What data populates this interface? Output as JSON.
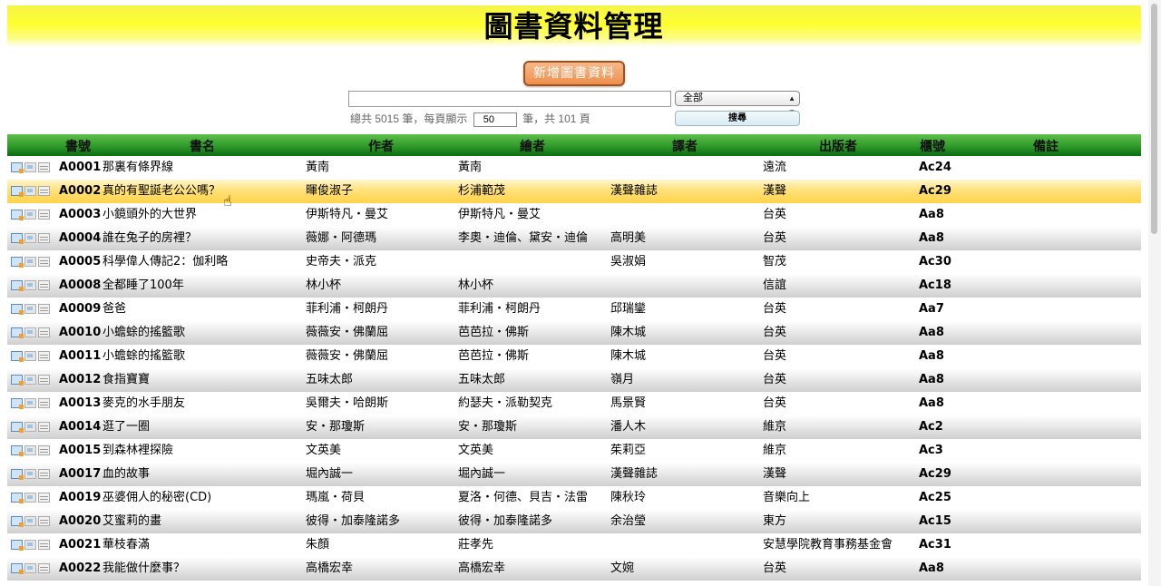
{
  "header": {
    "title": "圖書資料管理"
  },
  "actions": {
    "add_label": "新增圖書資料",
    "search_label": "搜尋"
  },
  "search": {
    "value": "",
    "category_selected": "全部"
  },
  "summary": {
    "prefix": "總共 5015 筆，每頁顯示",
    "per_page": "50",
    "suffix": "筆，共 101 頁"
  },
  "table": {
    "columns": [
      "書號",
      "書名",
      "作者",
      "繪者",
      "譯者",
      "出版者",
      "櫃號",
      "備註"
    ],
    "rows": [
      {
        "id": "A0001",
        "title": "那裏有條界線",
        "author": "黃南",
        "illustrator": "黃南",
        "translator": "",
        "publisher": "遠流",
        "shelf": "Ac24",
        "note": ""
      },
      {
        "id": "A0002",
        "title": "真的有聖誕老公公嗎？",
        "author": "暉俊淑子",
        "illustrator": "杉浦範茂",
        "translator": "漢聲雜誌",
        "publisher": "漢聲",
        "shelf": "Ac29",
        "note": ""
      },
      {
        "id": "A0003",
        "title": "小鏡頭外的大世界",
        "author": "伊斯特凡・曼艾",
        "illustrator": "伊斯特凡・曼艾",
        "translator": "",
        "publisher": "台英",
        "shelf": "Aa8",
        "note": ""
      },
      {
        "id": "A0004",
        "title": "誰在兔子的房裡？",
        "author": "薇娜・阿德瑪",
        "illustrator": "李奧・迪倫、黛安・迪倫",
        "translator": "高明美",
        "publisher": "台英",
        "shelf": "Aa8",
        "note": ""
      },
      {
        "id": "A0005",
        "title": "科學偉人傳記2：伽利略",
        "author": "史帝夫・派克",
        "illustrator": "",
        "translator": "吳淑娟",
        "publisher": "智茂",
        "shelf": "Ac30",
        "note": ""
      },
      {
        "id": "A0008",
        "title": "全都睡了100年",
        "author": "林小杯",
        "illustrator": "林小杯",
        "translator": "",
        "publisher": "信誼",
        "shelf": "Ac18",
        "note": ""
      },
      {
        "id": "A0009",
        "title": "爸爸",
        "author": "菲利浦・柯朗丹",
        "illustrator": "菲利浦・柯朗丹",
        "translator": "邱瑞鑾",
        "publisher": "台英",
        "shelf": "Aa7",
        "note": ""
      },
      {
        "id": "A0010",
        "title": "小蟾蜍的搖籃歌",
        "author": "薇薇安・佛蘭屈",
        "illustrator": "芭芭拉・佛斯",
        "translator": "陳木城",
        "publisher": "台英",
        "shelf": "Aa8",
        "note": ""
      },
      {
        "id": "A0011",
        "title": "小蟾蜍的搖籃歌",
        "author": "薇薇安・佛蘭屈",
        "illustrator": "芭芭拉・佛斯",
        "translator": "陳木城",
        "publisher": "台英",
        "shelf": "Aa8",
        "note": ""
      },
      {
        "id": "A0012",
        "title": "食指寶寶",
        "author": "五味太郎",
        "illustrator": "五味太郎",
        "translator": "嶺月",
        "publisher": "台英",
        "shelf": "Aa8",
        "note": ""
      },
      {
        "id": "A0013",
        "title": "麥克的水手朋友",
        "author": "吳爾夫・哈朗斯",
        "illustrator": "約瑟夫・派勒契克",
        "translator": "馬景賢",
        "publisher": "台英",
        "shelf": "Aa8",
        "note": ""
      },
      {
        "id": "A0014",
        "title": "逛了一圈",
        "author": "安・那瓊斯",
        "illustrator": "安・那瓊斯",
        "translator": "潘人木",
        "publisher": "維京",
        "shelf": "Ac2",
        "note": ""
      },
      {
        "id": "A0015",
        "title": "到森林裡探險",
        "author": "文英美",
        "illustrator": "文英美",
        "translator": "茱莉亞",
        "publisher": "維京",
        "shelf": "Ac3",
        "note": ""
      },
      {
        "id": "A0017",
        "title": "血的故事",
        "author": "堀內誠一",
        "illustrator": "堀內誠一",
        "translator": "漢聲雜誌",
        "publisher": "漢聲",
        "shelf": "Ac29",
        "note": ""
      },
      {
        "id": "A0019",
        "title": "巫婆佣人的秘密(CD)",
        "author": "瑪嵐・荷貝",
        "illustrator": "夏洛・何德、貝吉・法雷",
        "translator": "陳秋玲",
        "publisher": "音樂向上",
        "shelf": "Ac25",
        "note": ""
      },
      {
        "id": "A0020",
        "title": "艾蜜莉的畫",
        "author": "彼得・加泰隆諾多",
        "illustrator": "彼得・加泰隆諾多",
        "translator": "余治瑩",
        "publisher": "東方",
        "shelf": "Ac15",
        "note": ""
      },
      {
        "id": "A0021",
        "title": "華枝春滿",
        "author": "朱顏",
        "illustrator": "莊孝先",
        "translator": "",
        "publisher": "安慧學院教育事務基金會",
        "shelf": "Ac31",
        "note": ""
      },
      {
        "id": "A0022",
        "title": "我能做什麼事？",
        "author": "高橋宏幸",
        "illustrator": "高橋宏幸",
        "translator": "文婉",
        "publisher": "台英",
        "shelf": "Aa8",
        "note": ""
      }
    ]
  },
  "icons": {
    "row_edit": "edit-icon",
    "row_copy": "copy-icon",
    "row_delete": "delete-icon",
    "pointer": "hand-cursor-icon"
  }
}
